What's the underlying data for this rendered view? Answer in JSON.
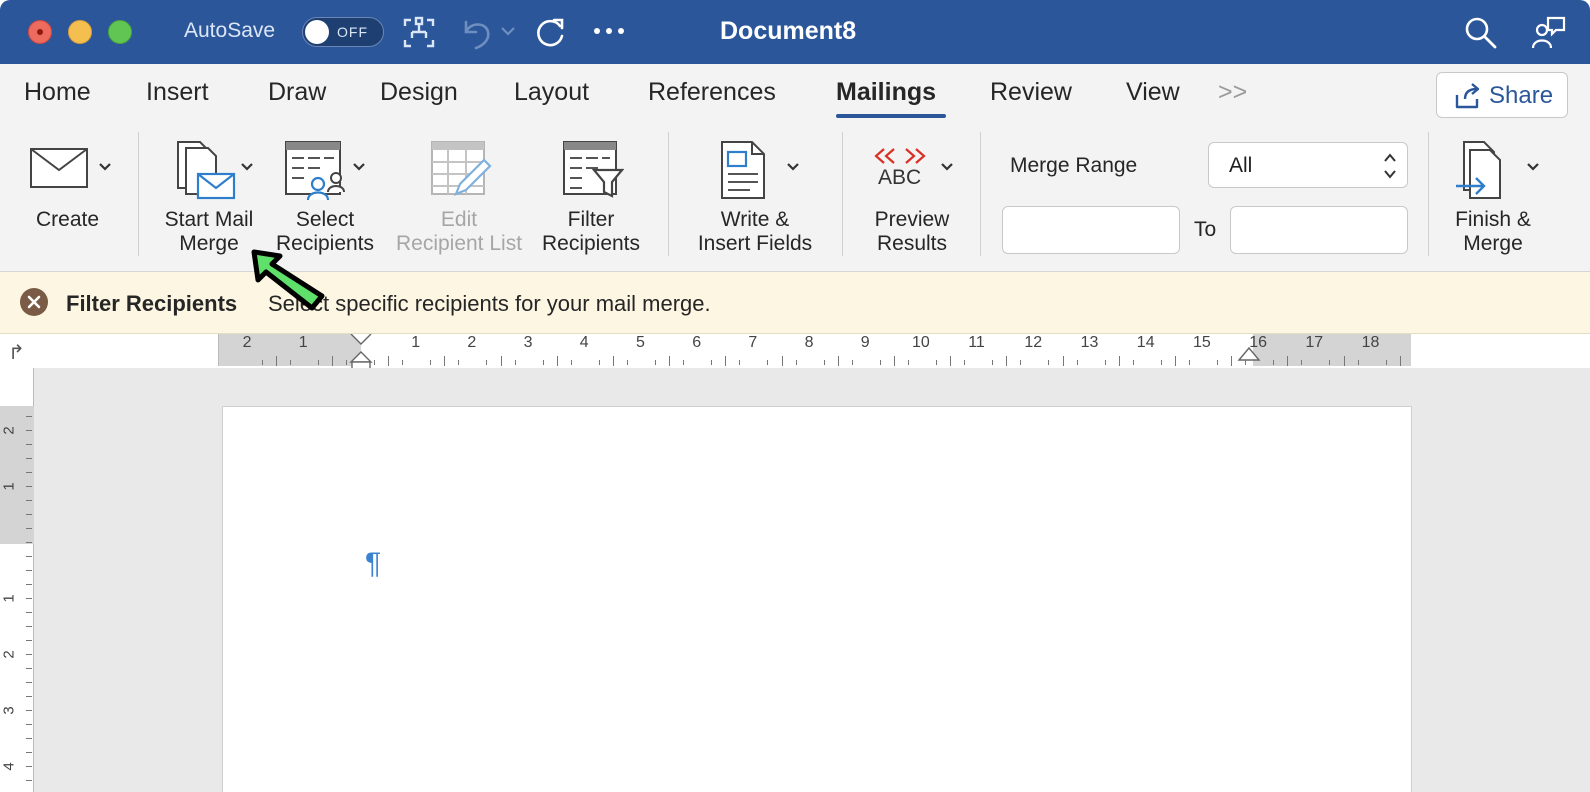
{
  "window": {
    "title": "Document8",
    "autosave_label": "AutoSave",
    "autosave_state": "OFF"
  },
  "tabs": [
    {
      "label": "Home"
    },
    {
      "label": "Insert"
    },
    {
      "label": "Draw"
    },
    {
      "label": "Design"
    },
    {
      "label": "Layout"
    },
    {
      "label": "References"
    },
    {
      "label": "Mailings",
      "active": true
    },
    {
      "label": "Review"
    },
    {
      "label": "View"
    }
  ],
  "tabs_overflow": ">>",
  "share_label": "Share",
  "ribbon": {
    "create": "Create",
    "start_mail_merge_1": "Start Mail",
    "start_mail_merge_2": "Merge",
    "select_recipients_1": "Select",
    "select_recipients_2": "Recipients",
    "edit_recipient_list_1": "Edit",
    "edit_recipient_list_2": "Recipient List",
    "filter_recipients_1": "Filter",
    "filter_recipients_2": "Recipients",
    "write_insert_1": "Write &",
    "write_insert_2": "Insert Fields",
    "preview_icon_text": "ABC",
    "preview_1": "Preview",
    "preview_2": "Results",
    "merge_range_label": "Merge Range",
    "merge_range_value": "All",
    "to_label": "To",
    "from_value": "",
    "to_value": "",
    "finish_1": "Finish &",
    "finish_2": "Merge"
  },
  "message_bar": {
    "title": "Filter Recipients",
    "text": "Select specific recipients for your mail merge."
  },
  "ruler": {
    "left_numbers": [
      "2",
      "1"
    ],
    "right_numbers": [
      "1",
      "2",
      "3",
      "4",
      "5",
      "6",
      "7",
      "8",
      "9",
      "10",
      "11",
      "12",
      "13",
      "14",
      "15",
      "16",
      "17",
      "18"
    ]
  },
  "vertical_ruler": {
    "numbers": [
      "2",
      "1",
      "1",
      "2",
      "3",
      "4"
    ]
  },
  "document": {
    "paragraph_mark": "¶"
  },
  "colors": {
    "titlebar": "#2b579a",
    "accent": "#2b579a",
    "message_bar": "#fdf6e3",
    "pointer": "#5fe06a"
  }
}
